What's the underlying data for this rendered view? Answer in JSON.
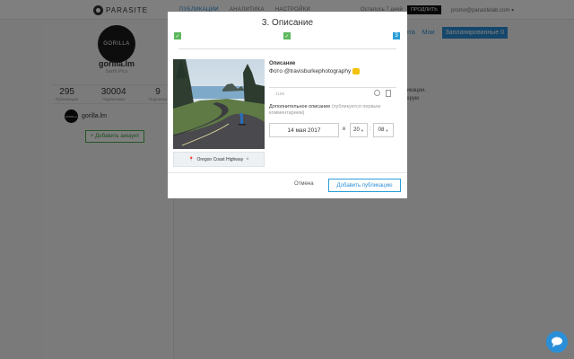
{
  "header": {
    "logo_text": "PARASITE",
    "nav": [
      "ПУБЛИКАЦИИ",
      "АНАЛИТИКА",
      "НАСТРОЙКИ"
    ],
    "trial_text": "Осталось 7 дней",
    "extend_label": "ПРОДЛИТЬ",
    "user_email": "promo@parasitelab.com ▾"
  },
  "sidebar": {
    "avatar_text": "GORILLA",
    "account_name": "gorilla.lm",
    "account_sub": "Sorth Pics",
    "stats": [
      {
        "value": "295",
        "label": "Публикации"
      },
      {
        "value": "30004",
        "label": "Подписчики"
      },
      {
        "value": "9",
        "label": "Подписки"
      }
    ],
    "account_row_name": "gorilla.lm",
    "small_avatar_text": "GORILLA",
    "add_account_label": "+ Добавить аккаунт"
  },
  "main": {
    "tab_partial": "ента",
    "tab_mine": "Мои",
    "tab_scheduled": "Запланированные 0",
    "side_text_line1": "ликации.",
    "side_text_line2": "перую"
  },
  "modal": {
    "title": "3. Описание",
    "steps": [
      {
        "state": "done",
        "glyph": "✓"
      },
      {
        "state": "done",
        "glyph": "✓"
      },
      {
        "state": "current",
        "glyph": "3"
      }
    ],
    "location": "Oregon Coast Highway",
    "location_remove": "×",
    "description_label": "Описание",
    "description_text": "Фото @travisburkephotography",
    "char_count": "2188",
    "extra_label": "Дополнительное описание",
    "extra_note": "(публикуется первым комментарием)",
    "date_value": "14 мая 2017",
    "at_label": "в",
    "hour_value": "20",
    "minute_value": "08",
    "colon": ":",
    "cancel_label": "Отмена",
    "submit_label": "Добавить публикацию"
  },
  "colors": {
    "accent": "#2a8fd8",
    "success": "#5cb85c",
    "overlay": "rgba(0,0,0,0.5)"
  }
}
